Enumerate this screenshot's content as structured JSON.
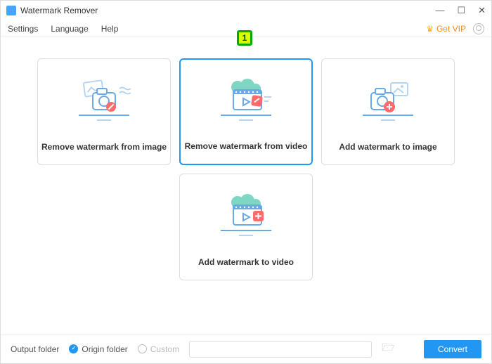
{
  "titlebar": {
    "title": "Watermark Remover"
  },
  "menubar": {
    "settings": "Settings",
    "language": "Language",
    "help": "Help",
    "get_vip": "Get VIP"
  },
  "cards": {
    "remove_image": "Remove watermark from image",
    "remove_video": "Remove watermark from video",
    "add_image": "Add watermark to image",
    "add_video": "Add watermark to video"
  },
  "badge": "1",
  "footer": {
    "output_folder": "Output folder",
    "origin_folder": "Origin folder",
    "custom": "Custom",
    "convert": "Convert"
  }
}
